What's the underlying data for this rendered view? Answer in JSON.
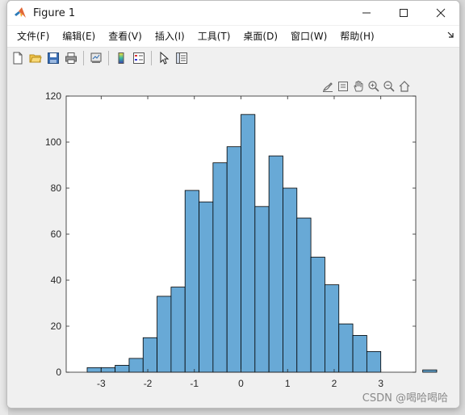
{
  "window": {
    "title": "Figure 1",
    "controls": {
      "minimize": "—",
      "maximize": "☐",
      "close": "✕"
    }
  },
  "menu": [
    "文件(F)",
    "编辑(E)",
    "查看(V)",
    "插入(I)",
    "工具(T)",
    "桌面(D)",
    "窗口(W)",
    "帮助(H)"
  ],
  "toolbar": [
    "new-figure-icon",
    "open-icon",
    "save-icon",
    "print-icon",
    "link-icon",
    "colorbar-icon",
    "legend-icon",
    "pointer-icon",
    "property-inspector-icon"
  ],
  "axes_toolbar": [
    "brush-icon",
    "datatips-icon",
    "pan-icon",
    "zoom-in-icon",
    "zoom-out-icon",
    "home-icon"
  ],
  "watermark": "CSDN @喝哈喝哈",
  "colors": {
    "bar_fill": "#68a9d6",
    "bar_edge": "#000000",
    "axes_bg": "#ffffff",
    "figure_bg": "#f0f0f0"
  },
  "chart_data": {
    "type": "bar",
    "title": "",
    "xlabel": "",
    "ylabel": "",
    "xlim": [
      -3.75,
      3.75
    ],
    "ylim": [
      0,
      120
    ],
    "xticks": [
      "-3",
      "-2",
      "-1",
      "0",
      "1",
      "2",
      "3"
    ],
    "xtick_values": [
      -3,
      -2,
      -1,
      0,
      1,
      2,
      3
    ],
    "yticks": [
      "0",
      "20",
      "40",
      "60",
      "80",
      "100",
      "120"
    ],
    "ytick_values": [
      0,
      20,
      40,
      60,
      80,
      100,
      120
    ],
    "bin_width": 0.3,
    "bin_edges_start": -3.3,
    "values": [
      2,
      2,
      3,
      6,
      15,
      33,
      37,
      79,
      74,
      91,
      98,
      112,
      72,
      94,
      80,
      67,
      50,
      38,
      21,
      16,
      9,
      0,
      0,
      0,
      1
    ],
    "grid": false,
    "legend": "none"
  }
}
